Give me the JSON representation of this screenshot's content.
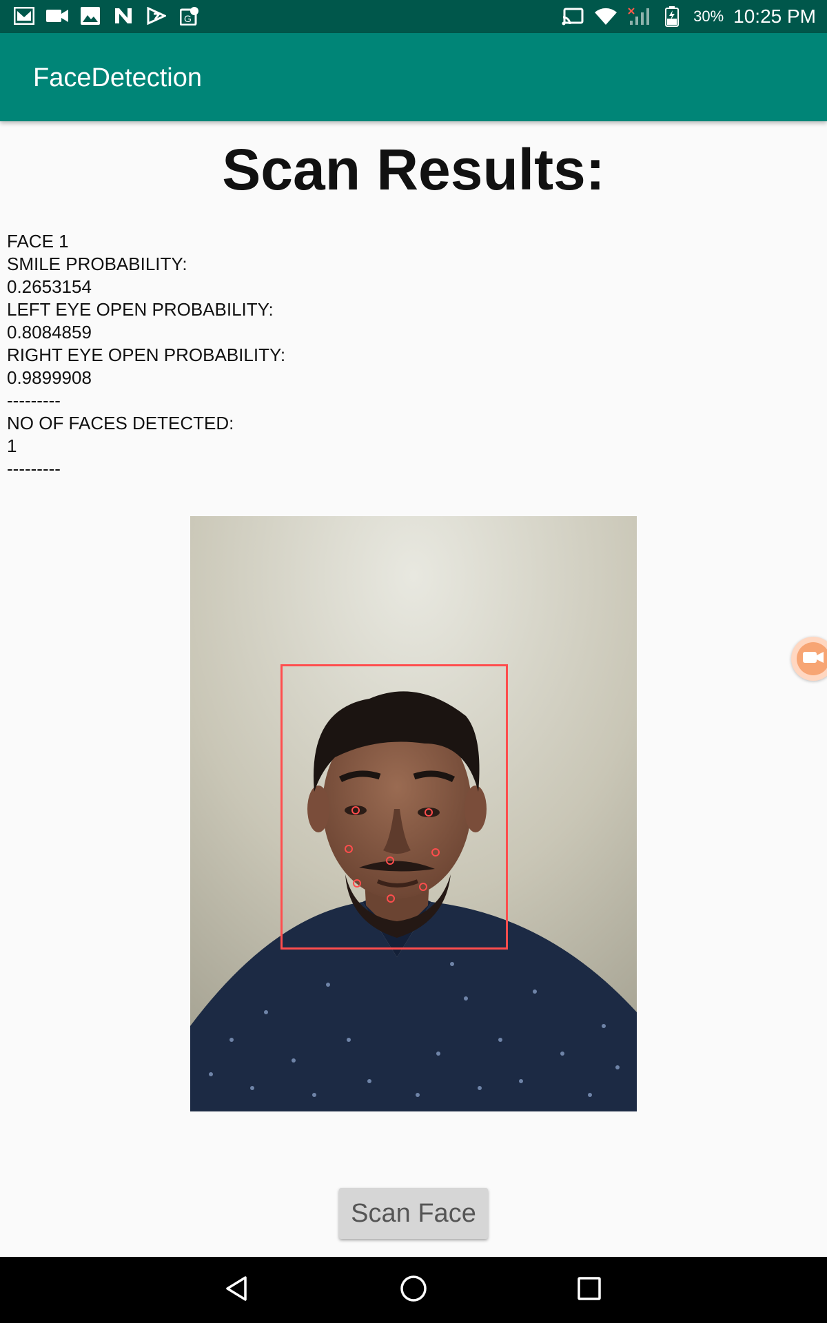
{
  "status_bar": {
    "left_icons": [
      "gmail-icon",
      "video-icon",
      "gallery-icon",
      "n-icon",
      "play-store-icon",
      "maps-icon"
    ],
    "battery": "30%",
    "time": "10:25 PM"
  },
  "app_bar": {
    "title": "FaceDetection"
  },
  "headline": "Scan Results:",
  "results": [
    "FACE 1",
    "SMILE PROBABILITY:",
    "0.2653154",
    "LEFT EYE OPEN PROBABILITY:",
    "0.8084859",
    "RIGHT EYE OPEN PROBABILITY:",
    "0.9899908",
    "---------",
    "NO OF FACES DETECTED:",
    "1",
    "---------"
  ],
  "scan_button": {
    "label": "Scan Face"
  },
  "colors": {
    "status_bar": "#00574b",
    "app_bar": "#008577",
    "detection": "#ff4d4d"
  }
}
